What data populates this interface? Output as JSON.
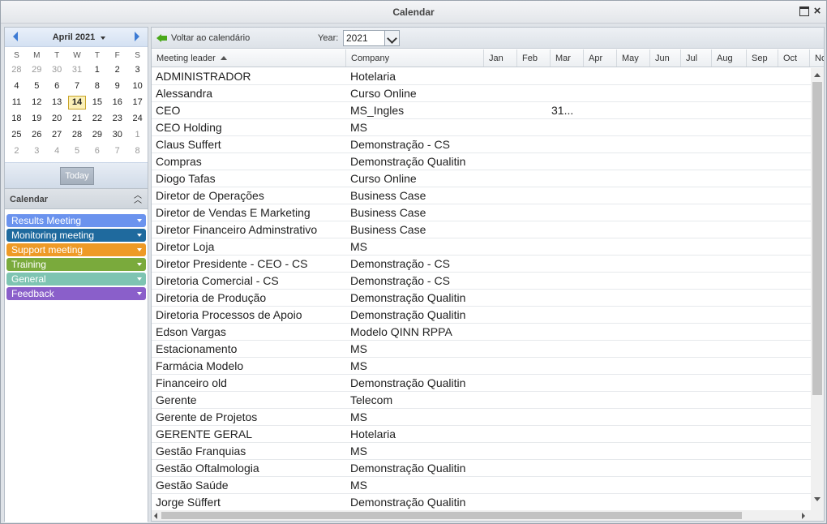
{
  "window": {
    "title": "Calendar"
  },
  "mini_calendar": {
    "month_label": "April 2021",
    "days_of_week": [
      "S",
      "M",
      "T",
      "W",
      "T",
      "F",
      "S"
    ],
    "weeks": [
      [
        {
          "d": "28",
          "o": true
        },
        {
          "d": "29",
          "o": true
        },
        {
          "d": "30",
          "o": true
        },
        {
          "d": "31",
          "o": true
        },
        {
          "d": "1"
        },
        {
          "d": "2"
        },
        {
          "d": "3"
        }
      ],
      [
        {
          "d": "4"
        },
        {
          "d": "5"
        },
        {
          "d": "6"
        },
        {
          "d": "7"
        },
        {
          "d": "8"
        },
        {
          "d": "9"
        },
        {
          "d": "10"
        }
      ],
      [
        {
          "d": "11"
        },
        {
          "d": "12"
        },
        {
          "d": "13"
        },
        {
          "d": "14",
          "t": true
        },
        {
          "d": "15"
        },
        {
          "d": "16"
        },
        {
          "d": "17"
        }
      ],
      [
        {
          "d": "18"
        },
        {
          "d": "19"
        },
        {
          "d": "20"
        },
        {
          "d": "21"
        },
        {
          "d": "22"
        },
        {
          "d": "23"
        },
        {
          "d": "24"
        }
      ],
      [
        {
          "d": "25"
        },
        {
          "d": "26"
        },
        {
          "d": "27"
        },
        {
          "d": "28"
        },
        {
          "d": "29"
        },
        {
          "d": "30"
        },
        {
          "d": "1",
          "o": true
        }
      ],
      [
        {
          "d": "2",
          "o": true
        },
        {
          "d": "3",
          "o": true
        },
        {
          "d": "4",
          "o": true
        },
        {
          "d": "5",
          "o": true
        },
        {
          "d": "6",
          "o": true
        },
        {
          "d": "7",
          "o": true
        },
        {
          "d": "8",
          "o": true
        }
      ]
    ],
    "today_label": "Today"
  },
  "calendar_panel": {
    "title": "Calendar",
    "items": [
      {
        "label": "Results Meeting",
        "color": "#6b93ee"
      },
      {
        "label": "Monitoring meeting",
        "color": "#1f6a9e"
      },
      {
        "label": "Support meeting",
        "color": "#ee9a26"
      },
      {
        "label": "Training",
        "color": "#7aaa3c"
      },
      {
        "label": "General",
        "color": "#7ec4b2"
      },
      {
        "label": "Feedback",
        "color": "#8a5fca"
      }
    ]
  },
  "toolbar": {
    "back_label": "Voltar ao calendário",
    "year_label": "Year:",
    "year_value": "2021"
  },
  "table": {
    "headers": {
      "leader": "Meeting leader",
      "company": "Company",
      "months": [
        "Jan",
        "Feb",
        "Mar",
        "Apr",
        "May",
        "Jun",
        "Jul",
        "Aug",
        "Sep",
        "Oct",
        "No"
      ]
    },
    "rows": [
      {
        "leader": "ADMINISTRADOR",
        "company": "Hotelaria",
        "mar": ""
      },
      {
        "leader": "Alessandra",
        "company": "Curso Online",
        "mar": ""
      },
      {
        "leader": "CEO",
        "company": "MS_Ingles",
        "mar": "31..."
      },
      {
        "leader": "CEO Holding",
        "company": "MS",
        "mar": ""
      },
      {
        "leader": "Claus Suffert",
        "company": "Demonstração - CS",
        "mar": ""
      },
      {
        "leader": "Compras",
        "company": "Demonstração Qualitin",
        "mar": ""
      },
      {
        "leader": "Diogo Tafas",
        "company": "Curso Online",
        "mar": ""
      },
      {
        "leader": "Diretor de Operações",
        "company": "Business Case",
        "mar": ""
      },
      {
        "leader": "Diretor de Vendas E Marketing",
        "company": "Business Case",
        "mar": ""
      },
      {
        "leader": "Diretor Financeiro Adminstrativo",
        "company": "Business Case",
        "mar": ""
      },
      {
        "leader": "Diretor Loja",
        "company": "MS",
        "mar": ""
      },
      {
        "leader": "Diretor Presidente - CEO - CS",
        "company": "Demonstração - CS",
        "mar": ""
      },
      {
        "leader": "Diretoria Comercial - CS",
        "company": "Demonstração - CS",
        "mar": ""
      },
      {
        "leader": "Diretoria de Produção",
        "company": "Demonstração Qualitin",
        "mar": ""
      },
      {
        "leader": "Diretoria Processos de Apoio",
        "company": "Demonstração Qualitin",
        "mar": ""
      },
      {
        "leader": "Edson Vargas",
        "company": "Modelo QINN RPPA",
        "mar": ""
      },
      {
        "leader": "Estacionamento",
        "company": "MS",
        "mar": ""
      },
      {
        "leader": "Farmácia Modelo",
        "company": "MS",
        "mar": ""
      },
      {
        "leader": "Financeiro old",
        "company": "Demonstração Qualitin",
        "mar": ""
      },
      {
        "leader": "Gerente",
        "company": "Telecom",
        "mar": ""
      },
      {
        "leader": "Gerente de Projetos",
        "company": "MS",
        "mar": ""
      },
      {
        "leader": "GERENTE GERAL",
        "company": "Hotelaria",
        "mar": ""
      },
      {
        "leader": "Gestão Franquias",
        "company": "MS",
        "mar": ""
      },
      {
        "leader": "Gestão Oftalmologia",
        "company": "Demonstração Qualitin",
        "mar": ""
      },
      {
        "leader": "Gestão Saúde",
        "company": "MS",
        "mar": ""
      },
      {
        "leader": "Jorge Süffert",
        "company": "Demonstração Qualitin",
        "mar": ""
      }
    ]
  }
}
